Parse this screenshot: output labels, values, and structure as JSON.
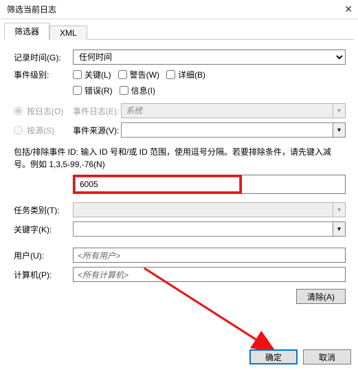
{
  "window": {
    "title": "筛选当前日志"
  },
  "tabs": {
    "filter": "筛选器",
    "xml": "XML"
  },
  "labels": {
    "logged_time": "记录时间(G):",
    "event_level": "事件级别:",
    "by_log": "按日志(O)",
    "by_source": "按源(S)",
    "event_log": "事件日志(E):",
    "event_source": "事件来源(V):",
    "help_text": "包括/排除事件 ID: 输入 ID 号和/或 ID 范围，使用逗号分隔。若要排除条件，请先键入减号。例如 1,3,5-99,-76(N)",
    "task_category": "任务类别(T):",
    "keyword": "关键字(K):",
    "user": "用户(U):",
    "computer": "计算机(P):"
  },
  "time_options_selected": "任何时间",
  "checkboxes": {
    "critical": "关键(L)",
    "warning": "警告(W)",
    "verbose": "详细(B)",
    "error": "错误(R)",
    "information": "信息(I)"
  },
  "event_log_value": "系统",
  "event_id_value": "6005",
  "user_value": "<所有用户>",
  "computer_value": "<所有计算机>",
  "buttons": {
    "clear": "清除(A)",
    "ok": "确定",
    "cancel": "取消"
  }
}
